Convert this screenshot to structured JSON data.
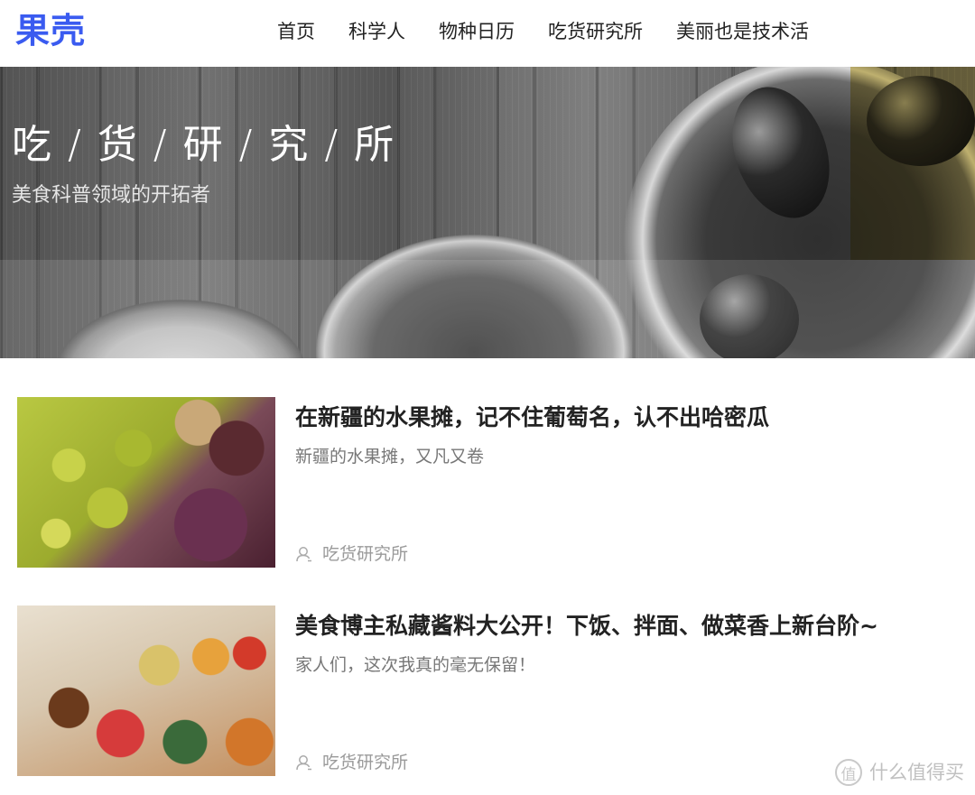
{
  "header": {
    "logo": "果壳",
    "nav": [
      "首页",
      "科学人",
      "物种日历",
      "吃货研究所",
      "美丽也是技术活"
    ]
  },
  "banner": {
    "title": "吃 / 货 / 研 / 究 / 所",
    "subtitle": "美食科普领域的开拓者"
  },
  "articles": [
    {
      "title": "在新疆的水果摊，记不住葡萄名，认不出哈密瓜",
      "description": "新疆的水果摊，又凡又卷",
      "author": "吃货研究所",
      "thumbnail": "grapes"
    },
    {
      "title": "美食博主私藏酱料大公开！下饭、拌面、做菜香上新台阶~",
      "description": "家人们，这次我真的毫无保留！",
      "author": "吃货研究所",
      "thumbnail": "sauces"
    }
  ],
  "watermark": {
    "icon_glyph": "值",
    "text": "什么值得买"
  },
  "colors": {
    "brand": "#3a5bf0"
  }
}
